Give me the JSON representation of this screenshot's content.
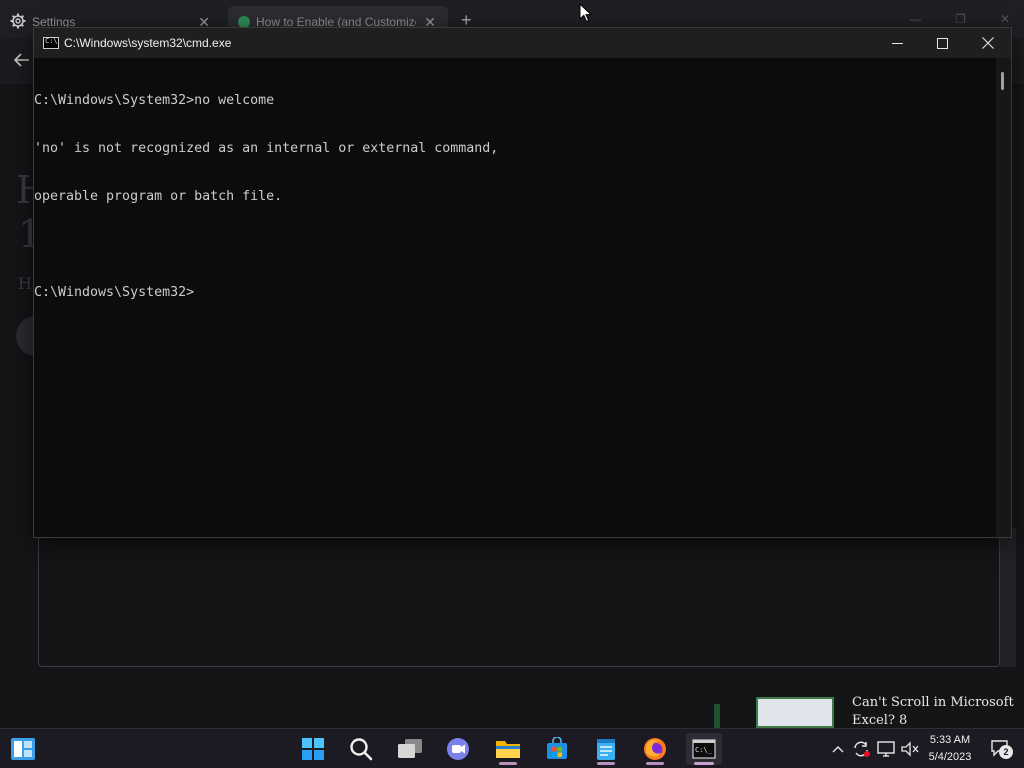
{
  "browser": {
    "tabs": [
      {
        "label": "Settings",
        "icon": "gear-icon",
        "close": "✕"
      },
      {
        "label": "How to Enable (and Customize",
        "icon": "site-favicon",
        "close": "✕"
      }
    ],
    "new_tab": "+",
    "ghost_text": {
      "headline_1": "H",
      "headline_2": "1",
      "byline": "H"
    },
    "promo": {
      "text": "Can't Scroll in Microsoft Excel? 8"
    }
  },
  "cmd": {
    "title": "C:\\Windows\\system32\\cmd.exe",
    "icon_glyph": "C:\\",
    "lines": [
      "C:\\Windows\\System32>no welcome",
      "'no' is not recognized as an internal or external command,",
      "operable program or batch file.",
      "",
      "C:\\Windows\\System32>"
    ],
    "colors": {
      "background": "#0c0c0c",
      "text": "#cccccc",
      "titlebar": "#1f1f1f"
    }
  },
  "taskbar": {
    "apps": [
      {
        "name": "Start",
        "icon": "windows-logo-icon"
      },
      {
        "name": "Search",
        "icon": "search-icon"
      },
      {
        "name": "Task View",
        "icon": "task-view-icon"
      },
      {
        "name": "Chat",
        "icon": "teams-chat-icon"
      },
      {
        "name": "File Explorer",
        "icon": "folder-icon"
      },
      {
        "name": "Microsoft Store",
        "icon": "store-icon"
      },
      {
        "name": "Notepad",
        "icon": "notepad-icon"
      },
      {
        "name": "Firefox",
        "icon": "firefox-icon"
      },
      {
        "name": "Command Prompt",
        "icon": "terminal-icon",
        "active": true
      }
    ],
    "clock": {
      "time": "5:33 AM",
      "date": "5/4/2023"
    },
    "notification_count": "2",
    "accent": "#c9a0cf"
  }
}
